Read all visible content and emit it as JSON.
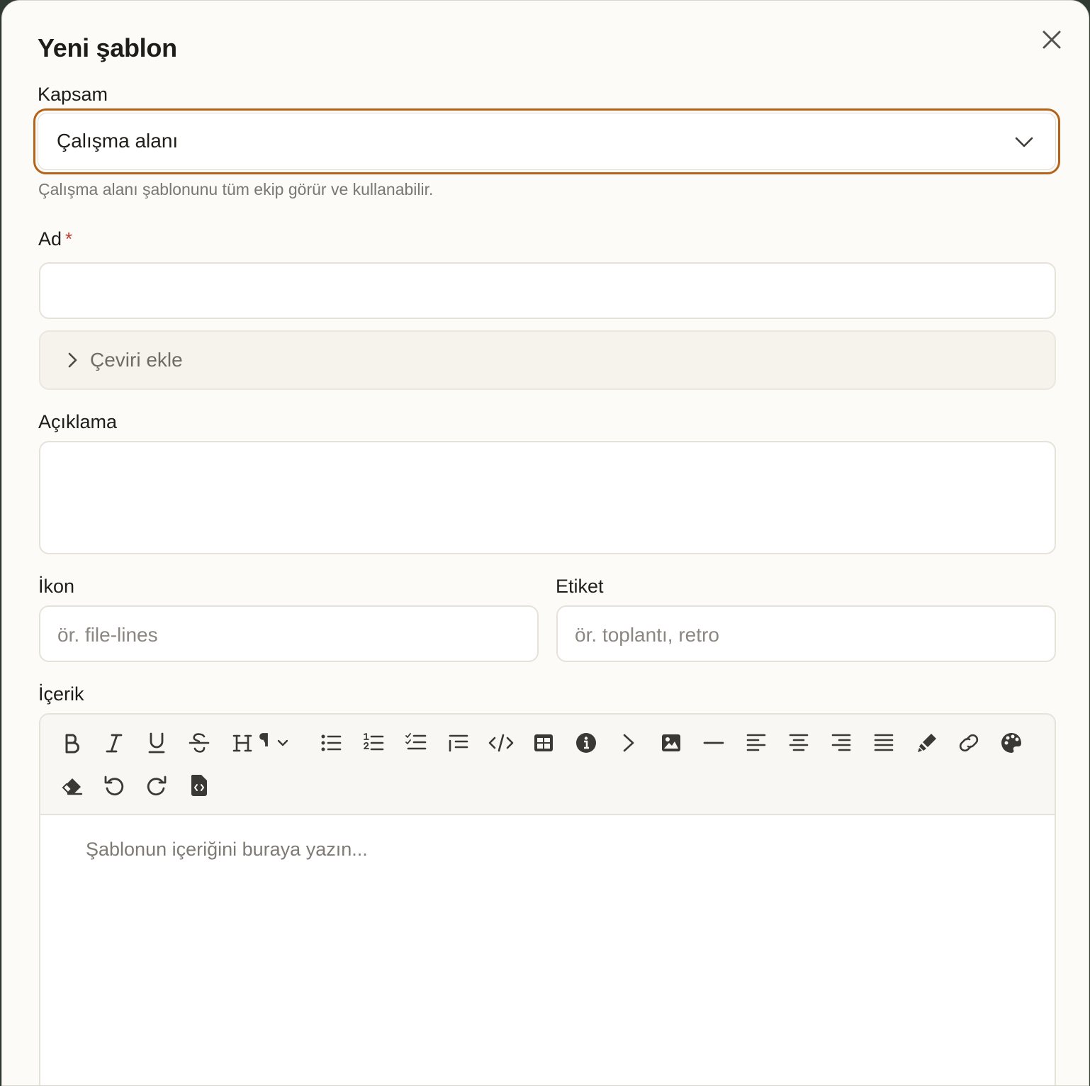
{
  "dialog": {
    "title": "Yeni şablon",
    "close_icon": "close-icon"
  },
  "scope": {
    "label": "Kapsam",
    "value": "Çalışma alanı",
    "help": "Çalışma alanı şablonunu tüm ekip görür ve kullanabilir."
  },
  "name": {
    "label": "Ad",
    "required_mark": "*",
    "value": ""
  },
  "translation": {
    "label": "Çeviri ekle"
  },
  "description": {
    "label": "Açıklama",
    "value": ""
  },
  "icon_field": {
    "label": "İkon",
    "placeholder": "ör. file-lines"
  },
  "tag_field": {
    "label": "Etiket",
    "placeholder": "ör. toplantı, retro"
  },
  "content": {
    "label": "İçerik",
    "placeholder": "Şablonun içeriğini buraya yazın...",
    "toolbar_icons": [
      "bold-icon",
      "italic-icon",
      "underline-icon",
      "strikethrough-icon",
      "heading-paragraph-dropdown-icon",
      "bullet-list-icon",
      "ordered-list-icon",
      "task-list-icon",
      "indent-list-icon",
      "code-icon",
      "table-icon",
      "info-icon",
      "chevron-right-icon",
      "image-icon",
      "horizontal-rule-icon",
      "align-left-icon",
      "align-center-icon",
      "align-right-icon",
      "align-justify-icon",
      "highlighter-icon",
      "link-icon",
      "palette-icon",
      "eraser-icon",
      "undo-icon",
      "redo-icon",
      "file-code-icon"
    ]
  },
  "colors": {
    "focus_ring": "#b5631a",
    "required": "#c0392b",
    "background": "#fcfbf8"
  }
}
